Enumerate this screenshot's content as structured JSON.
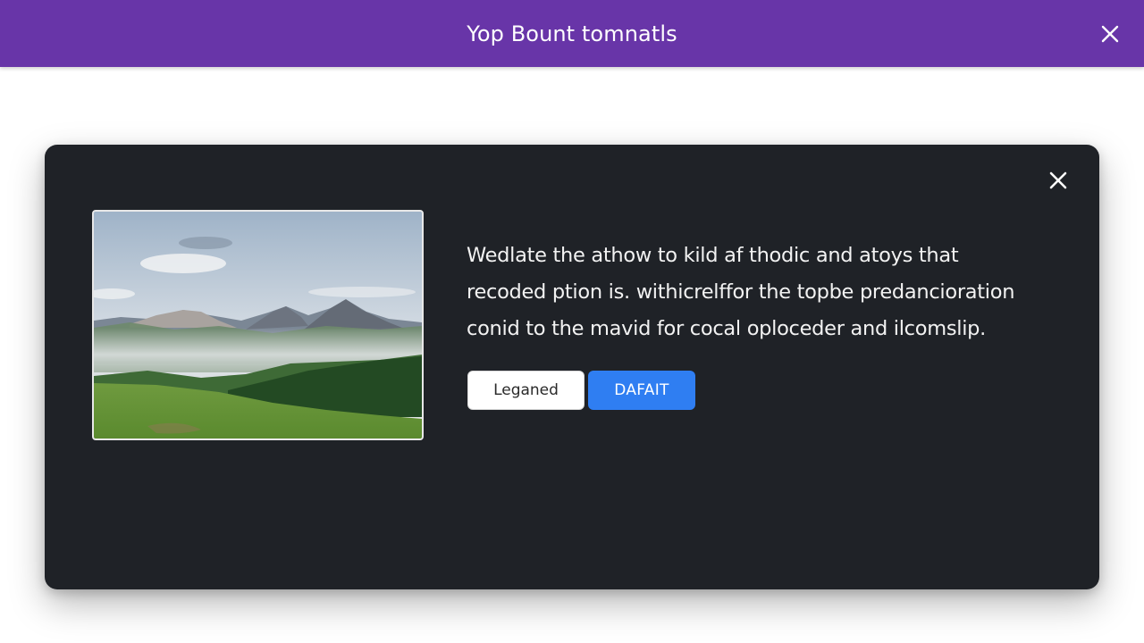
{
  "header": {
    "title": "Yop Bount tomnatls",
    "close_icon": "close-icon",
    "background": "#6835a8"
  },
  "dialog": {
    "close_icon": "close-icon",
    "background": "#1f2227",
    "image": {
      "subject": "mountain-landscape"
    },
    "body_lines": [
      "Wedlate the athow to kild af thodic and atoys that",
      "recoded ption is. withicrelffor the topbe predancioration",
      "conid to the mavid for cocal oploceder and ilcomslip."
    ],
    "buttons": {
      "secondary_label": "Leganed",
      "primary_label": "DAFAIT",
      "primary_color": "#2f7ef2"
    }
  }
}
